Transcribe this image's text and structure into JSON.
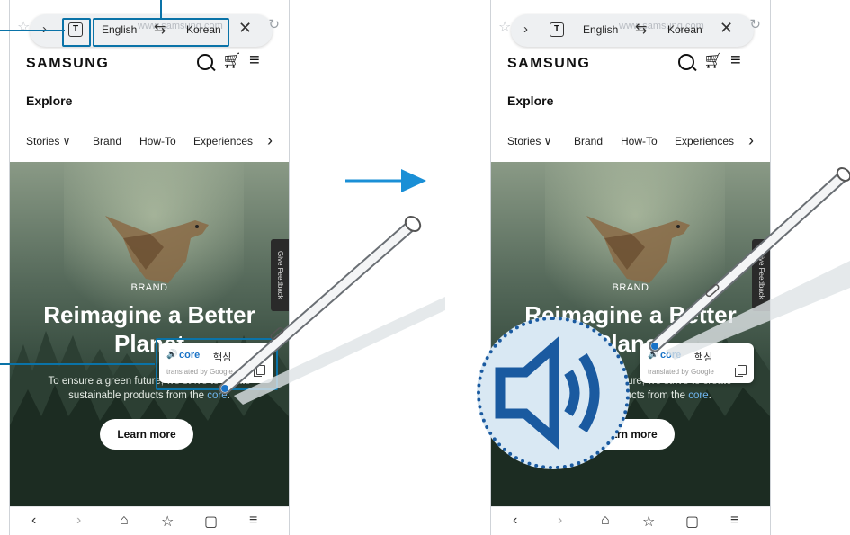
{
  "toolbar": {
    "source_lang": "English",
    "target_lang": "Korean",
    "url_ghost": "www.samsung.com",
    "text_icon": "T",
    "swap_icon": "⇆",
    "close_icon": "✕",
    "chevron_icon": "›",
    "reload_icon": "↻"
  },
  "header": {
    "logo": "SAMSUNG"
  },
  "page": {
    "explore": "Explore",
    "tabs": [
      "Stories ∨",
      "Brand",
      "How-To",
      "Experiences"
    ],
    "tabs_arrow": "›"
  },
  "hero": {
    "brand": "BRAND",
    "title_line1": "Reimagine a Better",
    "title_line2": "Planet",
    "subtitle_line1_prefix": "To ensure a green future, we strive to create",
    "subtitle_line2_prefix": "sustainable products from the ",
    "subtitle_core": "core",
    "subtitle_end": ".",
    "learn_more": "Learn more",
    "feedback": "Give Feedback"
  },
  "popup": {
    "speaker_icon": "🔊",
    "word": "core",
    "translation": "핵심",
    "credit": "translated by Google"
  },
  "bottom_nav": {
    "back": "‹",
    "forward": "›",
    "home": "⌂",
    "bookmark": "☆",
    "tabs": "▢",
    "menu": "≡"
  },
  "colors": {
    "accent": "#0a73a8",
    "link_blue": "#1a73c7",
    "arrow_blue": "#1a8fd6"
  }
}
